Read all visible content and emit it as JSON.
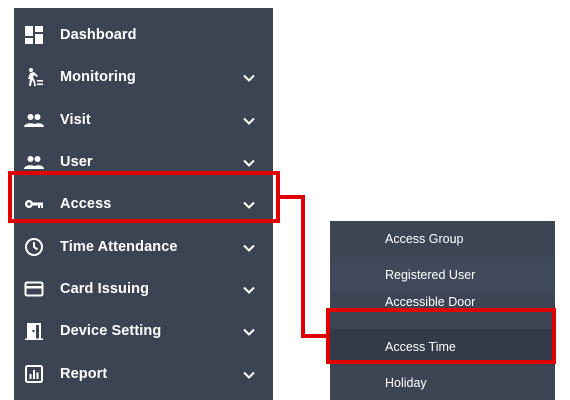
{
  "sidebar": {
    "items": [
      {
        "label": "Dashboard",
        "icon": "dashboard-icon",
        "has_chevron": false
      },
      {
        "label": "Monitoring",
        "icon": "monitoring-icon",
        "has_chevron": true
      },
      {
        "label": "Visit",
        "icon": "visit-icon",
        "has_chevron": true
      },
      {
        "label": "User",
        "icon": "user-icon",
        "has_chevron": true
      },
      {
        "label": "Access",
        "icon": "key-icon",
        "has_chevron": true,
        "highlighted": true
      },
      {
        "label": "Time Attendance",
        "icon": "clock-icon",
        "has_chevron": true
      },
      {
        "label": "Card Issuing",
        "icon": "card-icon",
        "has_chevron": true
      },
      {
        "label": "Device Setting",
        "icon": "door-icon",
        "has_chevron": true
      },
      {
        "label": "Report",
        "icon": "report-icon",
        "has_chevron": true
      }
    ]
  },
  "submenu": {
    "items": [
      {
        "label": "Access Group"
      },
      {
        "label": "Registered User"
      },
      {
        "label": "Accessible Door",
        "partially_hidden": true
      },
      {
        "label": "Access Time",
        "highlighted": true
      },
      {
        "label": "Holiday"
      }
    ]
  },
  "colors": {
    "sidebar_bg": "#3c4454",
    "submenu_bg": "#3d4555",
    "highlight": "#e00000",
    "text": "#ffffff"
  }
}
